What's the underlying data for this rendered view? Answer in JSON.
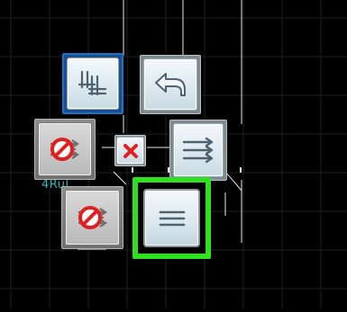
{
  "canvas": {
    "background": "#000000",
    "grid_color": "#202020",
    "line_color": "#ffffff",
    "label_color": "#32c8d2"
  },
  "cad_label": "4Rul",
  "tools": [
    {
      "id": "stack",
      "icon": "stacked-lines-icon",
      "selected": true,
      "selection_color": "#1a73c9"
    },
    {
      "id": "undo",
      "icon": "undo-arrow-icon"
    },
    {
      "id": "forbidden-upper",
      "icon": "no-forward-icon"
    },
    {
      "id": "delete",
      "icon": "red-x-icon",
      "accent": "#e02020"
    },
    {
      "id": "forward-lines",
      "icon": "triple-arrow-right-icon"
    },
    {
      "id": "forbidden-lower",
      "icon": "no-forward-icon"
    },
    {
      "id": "menu",
      "icon": "hamburger-menu-icon",
      "highlighted": true,
      "highlight_color": "#2ee020"
    }
  ]
}
